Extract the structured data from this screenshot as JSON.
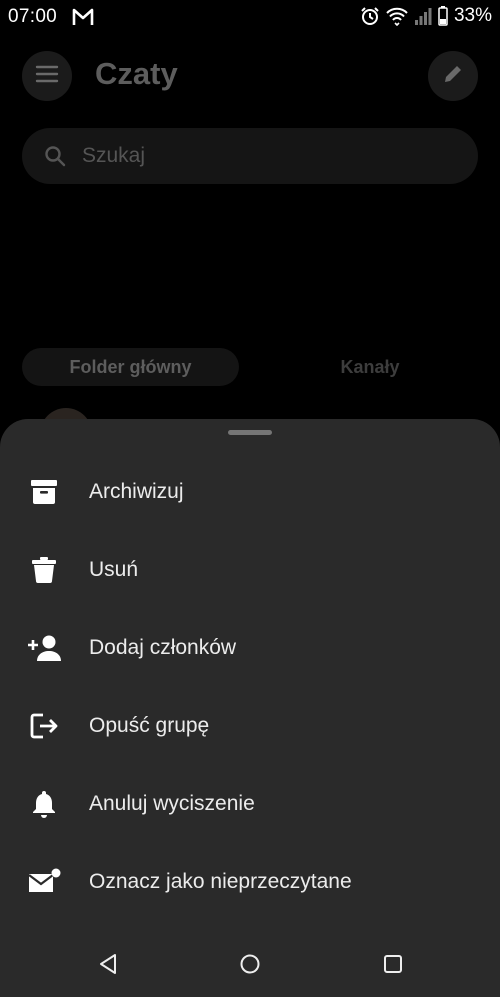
{
  "status_bar": {
    "time": "07:00",
    "battery": "33%",
    "icons": [
      "gmail-icon",
      "alarm-icon",
      "wifi-icon",
      "signal-icon",
      "battery-icon"
    ]
  },
  "header": {
    "title": "Czaty",
    "menu_icon": "hamburger-menu-icon",
    "edit_icon": "pencil-icon"
  },
  "search": {
    "placeholder": "Szukaj"
  },
  "tabs": [
    {
      "label": "Folder główny",
      "selected": true
    },
    {
      "label": "Kanały",
      "selected": false
    }
  ],
  "sheet": {
    "items": [
      {
        "label": "Archiwizuj",
        "icon": "archive-icon"
      },
      {
        "label": "Usuń",
        "icon": "trash-icon"
      },
      {
        "label": "Dodaj członków",
        "icon": "add-person-icon"
      },
      {
        "label": "Opuść grupę",
        "icon": "leave-group-icon"
      },
      {
        "label": "Anuluj wyciszenie",
        "icon": "bell-icon"
      },
      {
        "label": "Oznacz jako nieprzeczytane",
        "icon": "mark-unread-icon"
      }
    ]
  },
  "nav_bar": {
    "buttons": [
      "back-icon",
      "home-icon",
      "recents-icon"
    ]
  },
  "colors": {
    "background": "#000000",
    "sheet": "#2a2a2a",
    "text": "#ececec"
  }
}
